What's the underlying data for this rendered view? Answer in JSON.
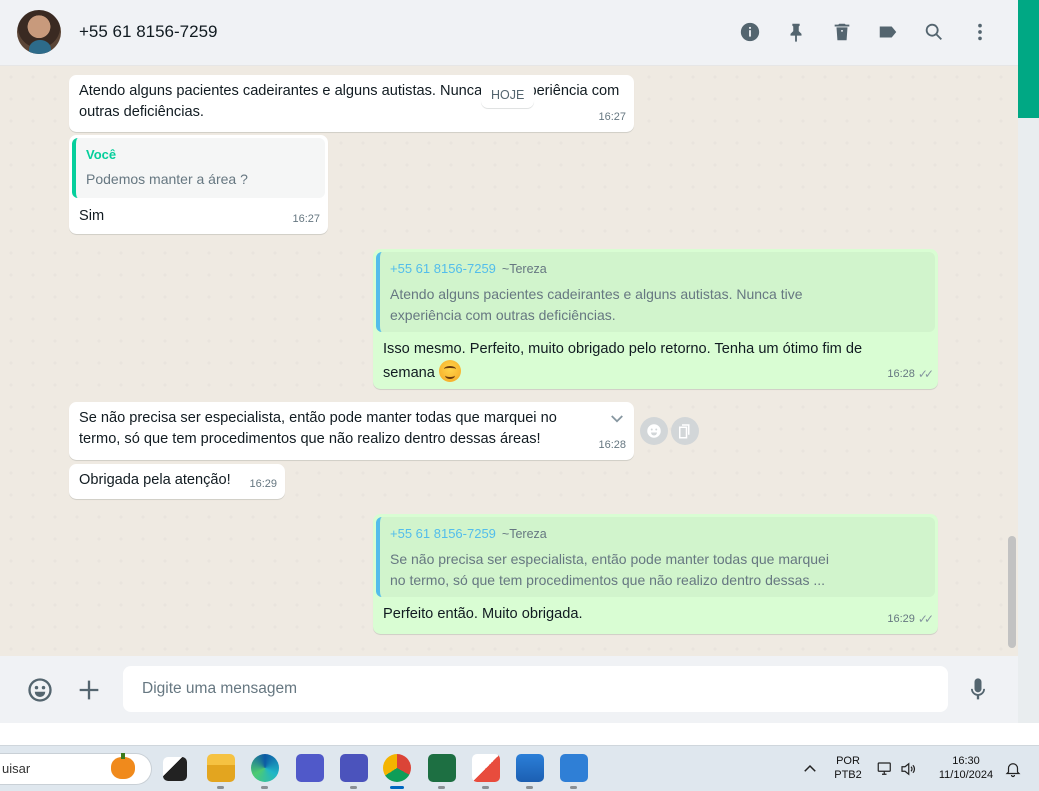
{
  "header": {
    "contact_name": "+55 61 8156-7259",
    "icons": [
      "info-icon",
      "pin-icon",
      "delete-icon",
      "label-icon",
      "search-icon",
      "menu-icon"
    ]
  },
  "chat": {
    "date_badge": "HOJE",
    "messages": [
      {
        "direction": "in",
        "text": "Atendo alguns pacientes  cadeirantes e alguns autistas. Nunca tive experiência com outras deficiências.",
        "time": "16:27"
      },
      {
        "direction": "in",
        "quote_author": "Você",
        "quote_text": "Podemos manter a área ?",
        "text": "Sim",
        "time": "16:27"
      },
      {
        "direction": "out",
        "quote_author": "+55 61 8156-7259",
        "quote_sub": "~Tereza",
        "quote_text_1": "Atendo alguns pacientes  cadeirantes e alguns autistas. Nunca tive",
        "quote_text_2": "experiência  com outras deficiências.",
        "text_1": "Isso mesmo. Perfeito, muito obrigado pelo retorno. Tenha um ótimo fim de",
        "text_2": "semana",
        "time": "16:28"
      },
      {
        "direction": "in",
        "text_1": "Se não precisa ser especialista,  então pode manter todas que marquei no",
        "text_2": "termo, só que tem procedimentos  que não realizo dentro dessas áreas!",
        "time": "16:28"
      },
      {
        "direction": "in",
        "text": "Obrigada pela atenção!",
        "time": "16:29"
      },
      {
        "direction": "out",
        "quote_author": "+55 61 8156-7259",
        "quote_sub": "~Tereza",
        "quote_text_1": "Se não precisa ser especialista,  então pode manter todas que marquei",
        "quote_text_2": "no termo, só que tem procedimentos  que não realizo dentro dessas ...",
        "text": "Perfeito então. Muito obrigada.",
        "time": "16:29"
      }
    ]
  },
  "composer": {
    "placeholder": "Digite uma mensagem"
  },
  "taskbar": {
    "search_text": "uisar",
    "language_1": "POR",
    "language_2": "PTB2",
    "clock_time": "16:30",
    "clock_date": "11/10/2024"
  },
  "colors": {
    "chat_bg": "#efeae2",
    "incoming": "#ffffff",
    "outgoing": "#d9fdd3",
    "accent": "#00a884",
    "quote_me": "#06cf9c",
    "quote_other": "#53bdeb"
  }
}
